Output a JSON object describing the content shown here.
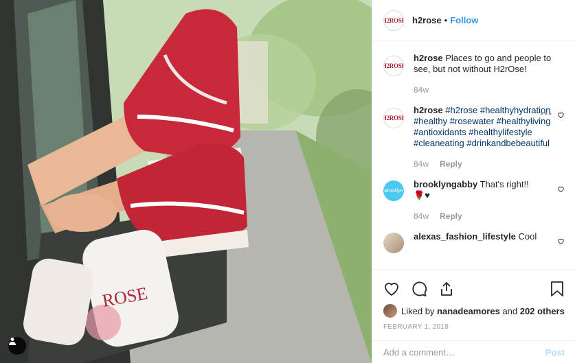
{
  "post": {
    "username": "h2rose",
    "separator": "•",
    "follow_label": "Follow",
    "avatar_logo": "H2ROSE"
  },
  "comments": [
    {
      "user": "h2rose",
      "text": "Places to go and people to see, but not without H2rOse!",
      "time": "84w"
    },
    {
      "user": "h2rose",
      "hashtags": "#h2rose #healthyhydration #healthy #rosewater #healthyliving #antioxidants #healthylifestyle #cleaneating #drinkandbebeautiful",
      "time": "84w",
      "reply_label": "Reply"
    },
    {
      "user": "brooklyngabby",
      "text": "That's right!!",
      "emoji": "🌹♥",
      "time": "84w",
      "reply_label": "Reply",
      "avatar_text": "Brooklyn"
    },
    {
      "user": "alexas_fashion_lifestyle",
      "text": "Cool"
    }
  ],
  "likes": {
    "prefix": "Liked by",
    "user": "nanadeamores",
    "and": "and",
    "others": "202 others"
  },
  "date": "FEBRUARY 1, 2018",
  "add_comment": {
    "placeholder": "Add a comment…",
    "post_label": "Post"
  },
  "colors": {
    "accent": "#3897f0",
    "hashtag": "#003569",
    "muted": "#999999",
    "shoe_red": "#c8283a"
  },
  "icons": [
    "tag-user-icon",
    "more-options-icon",
    "heart-icon",
    "comment-icon",
    "share-icon",
    "bookmark-icon"
  ]
}
